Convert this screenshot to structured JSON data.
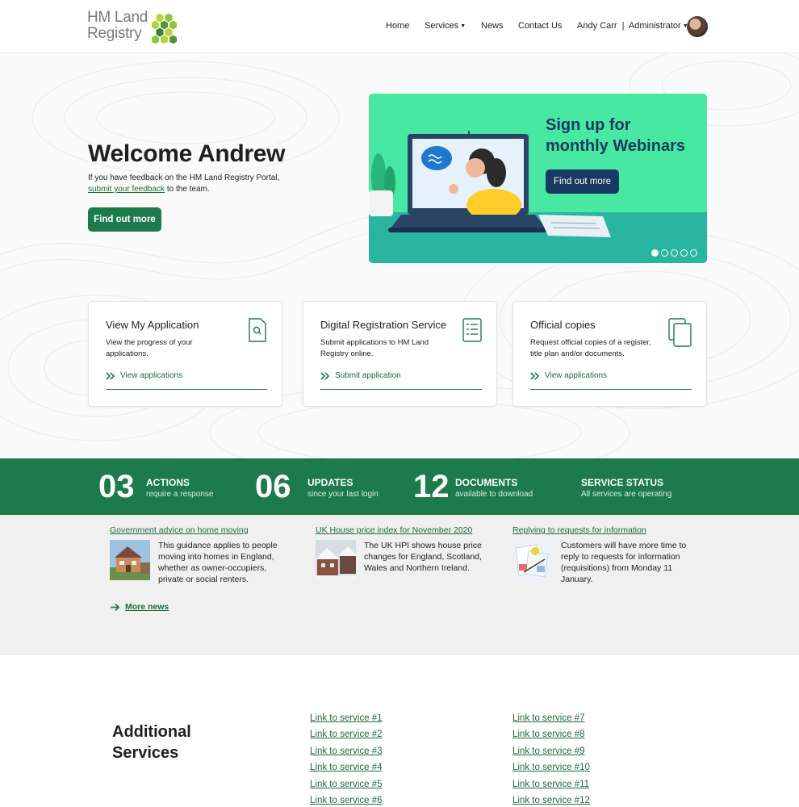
{
  "header": {
    "logo_line1": "HM Land",
    "logo_line2": "Registry",
    "nav": {
      "home": "Home",
      "services": "Services",
      "news": "News",
      "contact": "Contact Us",
      "user_name": "Andy Carr",
      "separator": "|",
      "role": "Administrator"
    }
  },
  "hero": {
    "welcome": "Welcome Andrew",
    "feedback_prefix": "If you have feedback on the HM Land Registry Portal,",
    "feedback_link": "submit your feedback",
    "feedback_suffix": " to the team.",
    "button": "Find out more"
  },
  "banner": {
    "title_line1": "Sign up for",
    "title_line2": "monthly Webinars",
    "button": "Find out more",
    "slides_total": 5,
    "active_slide": 1
  },
  "cards": [
    {
      "title": "View My Application",
      "description": "View the progress of your applications.",
      "link": "View applications",
      "icon": "document-search-icon"
    },
    {
      "title": "Digital Registration Service",
      "description": "Submit applications to HM Land Registry online.",
      "link": "Submit application",
      "icon": "form-list-icon"
    },
    {
      "title": "Official copies",
      "description": "Request official copies of a register, title plan and/or documents.",
      "link": "View applications",
      "icon": "copies-icon"
    }
  ],
  "stats": [
    {
      "number": "03",
      "label": "ACTIONS",
      "sub": "require a response"
    },
    {
      "number": "06",
      "label": "UPDATES",
      "sub": "since your last login"
    },
    {
      "number": "12",
      "label": "DOCUMENTS",
      "sub": "available to download"
    },
    {
      "number": "",
      "label": "SERVICE STATUS",
      "sub": "All services are operating"
    }
  ],
  "news": {
    "items": [
      {
        "title": "Government advice on home moving",
        "text": "This guidance applies to people moving into homes in England, whether as owner-occupiers, private or social renters."
      },
      {
        "title": "UK House price index for November 2020",
        "text": "The UK HPI shows house price changes for England, Scotland, Wales and Northern Ireland."
      },
      {
        "title": "Replying to requests for information",
        "text": "Customers will have more time to reply to requests for information (requisitions) from Monday 11 January."
      }
    ],
    "more": "More news"
  },
  "additional": {
    "title_line1": "Additional",
    "title_line2": "Services",
    "links": [
      "Link to service #1",
      "Link to service #2",
      "Link to service #3",
      "Link to service #4",
      "Link to service #5",
      "Link to service #6",
      "Link to service #7",
      "Link to service #8",
      "Link to service #9",
      "Link to service #10",
      "Link to service #11",
      "Link to service #12"
    ]
  },
  "colors": {
    "brand_green": "#1d7a4b",
    "banner_mint": "#48e8a3",
    "banner_navy": "#173a63"
  }
}
